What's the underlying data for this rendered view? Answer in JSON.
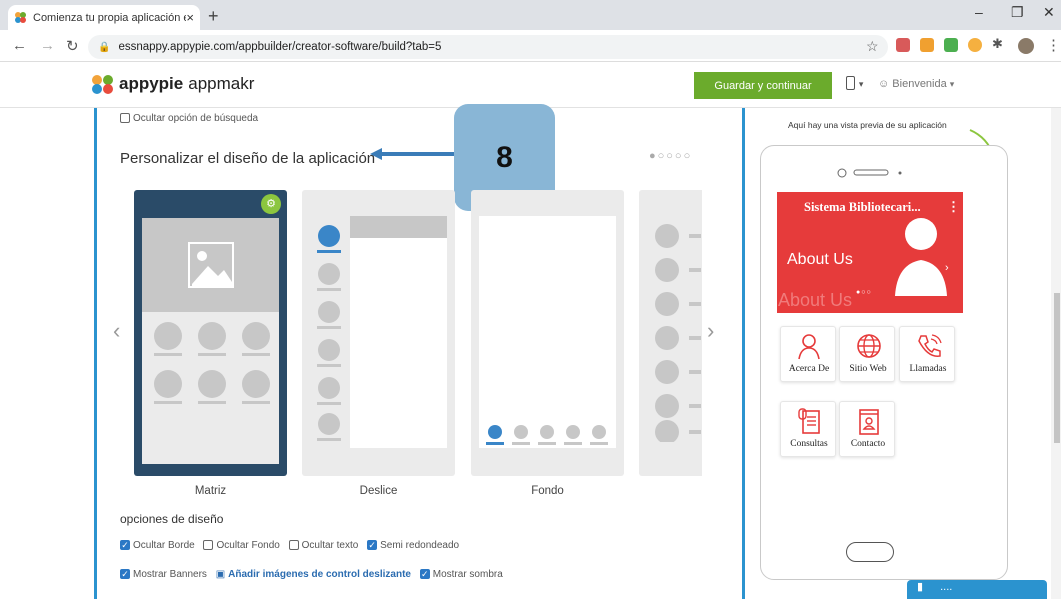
{
  "browser": {
    "tab_title": "Comienza tu propia aplicación e",
    "tab_close": "×",
    "new_tab": "+",
    "url": "essnappy.appypie.com/appbuilder/creator-software/build?tab=5",
    "window_min": "–",
    "window_max": "❐",
    "window_close": "✕"
  },
  "header": {
    "logo_brand": "appypie",
    "logo_product": "appmakr",
    "save_button": "Guardar y continuar",
    "welcome": "Bienvenida"
  },
  "design": {
    "hide_search_label": "Ocultar opción de búsqueda",
    "section_title": "Personalizar el diseño de la aplicación",
    "callout_number": "8",
    "layouts": [
      {
        "label": "Matriz",
        "selected": true
      },
      {
        "label": "Deslice",
        "selected": false
      },
      {
        "label": "Fondo",
        "selected": false
      },
      {
        "label": "",
        "selected": false
      }
    ],
    "options_title": "opciones de diseño",
    "options_row1": [
      {
        "label": "Ocultar Borde",
        "checked": true
      },
      {
        "label": "Ocultar Fondo",
        "checked": false
      },
      {
        "label": "Ocultar texto",
        "checked": false
      },
      {
        "label": "Semi redondeado",
        "checked": true
      }
    ],
    "options_row2": [
      {
        "label": "Mostrar Banners",
        "checked": true
      },
      {
        "label": "Añadir imágenes de control deslizante",
        "link": true
      },
      {
        "label": "Mostrar sombra",
        "checked": true
      }
    ]
  },
  "preview": {
    "note": "Aquí hay una vista previa de su aplicación",
    "app_title": "Sistema Bibliotecari...",
    "banner_title": "About Us",
    "banner_ghost": "About Us",
    "tiles": [
      {
        "label": "Acerca De",
        "icon": "person-icon"
      },
      {
        "label": "Sitio Web",
        "icon": "globe-icon"
      },
      {
        "label": "Llamadas",
        "icon": "phone-icon"
      },
      {
        "label": "Consultas",
        "icon": "document-icon"
      },
      {
        "label": "Contacto",
        "icon": "contact-book-icon"
      }
    ],
    "accent_color": "#e63b3b"
  },
  "chat": {
    "label": "...."
  },
  "colors": {
    "brand_green": "#6bab2c",
    "brand_blue": "#2b93cf",
    "selected_card": "#2a4b68"
  }
}
